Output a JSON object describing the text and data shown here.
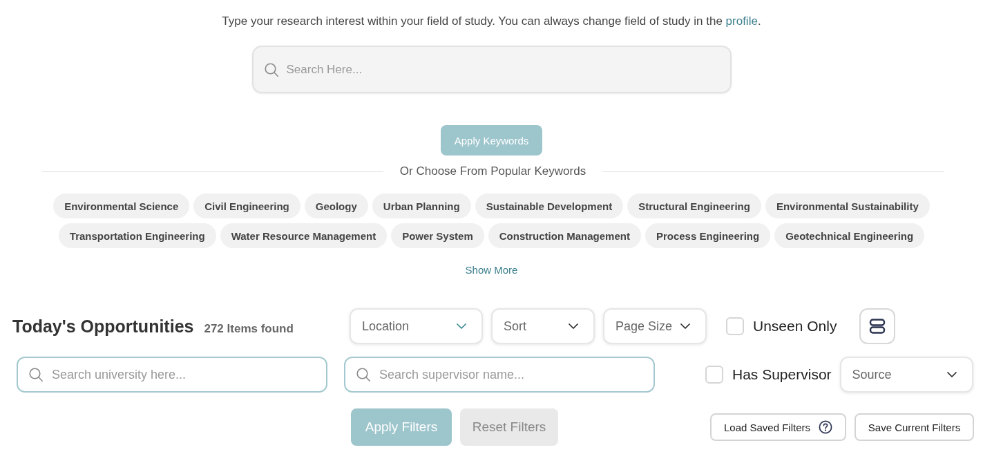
{
  "intro": {
    "text": "Type your research interest within your field of study. You can always change field of study in the ",
    "link": "profile",
    "after": "."
  },
  "keyword_search": {
    "placeholder": "Search Here..."
  },
  "apply_keywords_button": "Apply Keywords",
  "popular_keywords": {
    "heading": "Or Choose From Popular Keywords",
    "keywords": [
      "Environmental Science",
      "Civil Engineering",
      "Geology",
      "Urban Planning",
      "Sustainable Development",
      "Structural Engineering",
      "Environmental Sustainability",
      "Transportation Engineering",
      "Water Resource Management",
      "Power System",
      "Construction Management",
      "Process Engineering",
      "Geotechnical Engineering"
    ],
    "show_more": "Show More"
  },
  "opportunities": {
    "title": "Today's Opportunities",
    "count": "272 Items found",
    "dropdowns": [
      {
        "placeholder": "Location",
        "active": true
      },
      {
        "placeholder": "Sort",
        "active": false
      },
      {
        "placeholder": "Page Size",
        "active": false
      }
    ],
    "unseen_only": {
      "label": "Unseen Only",
      "checked": false
    },
    "university_search": {
      "placeholder": "Search university here..."
    },
    "supervisor_search": {
      "placeholder": "Search supervisor name..."
    },
    "has_supervisor": {
      "label": "Has Supervisor",
      "checked": false
    },
    "source_dropdown": {
      "placeholder": "Source",
      "active": false
    },
    "buttons": [
      {
        "label": "Apply Filters",
        "kind": "primary",
        "help": false
      },
      {
        "label": "Reset Filters",
        "kind": "muted",
        "help": false
      },
      {
        "label": "Load Saved Filters",
        "kind": "outline",
        "help": true
      },
      {
        "label": "Save Current Filters",
        "kind": "outline",
        "help": false
      }
    ]
  }
}
